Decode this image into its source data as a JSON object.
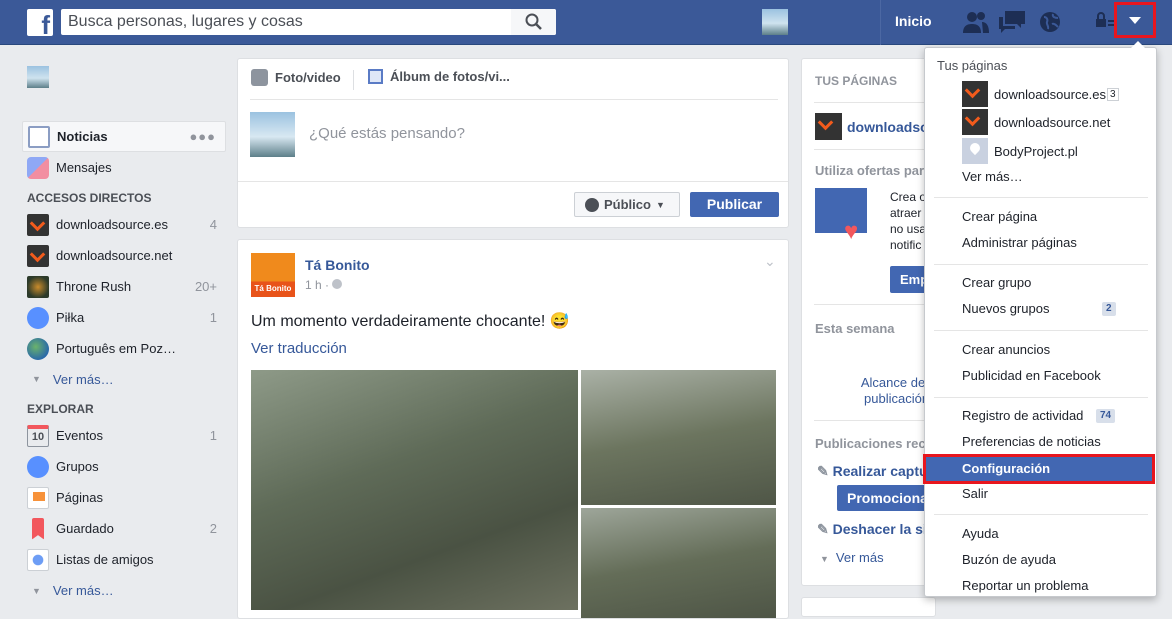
{
  "topbar": {
    "logo": "f",
    "search_placeholder": "Busca personas, lugares y cosas",
    "home": "Inicio",
    "icons": [
      "friend-requests-icon",
      "messages-icon",
      "notifications-globe-icon",
      "privacy-lock-icon",
      "account-menu-icon"
    ]
  },
  "sidebar": {
    "main": [
      {
        "label": "Noticias",
        "icon": "news-feed-icon"
      },
      {
        "label": "Mensajes",
        "icon": "messages-icon"
      }
    ],
    "shortcuts_title": "ACCESOS DIRECTOS",
    "shortcuts": [
      {
        "label": "downloadsource.es",
        "count": "4"
      },
      {
        "label": "downloadsource.net",
        "count": ""
      },
      {
        "label": "Throne Rush",
        "count": "20+"
      },
      {
        "label": "Piłka",
        "count": "1"
      },
      {
        "label": "Português em Poz…",
        "count": ""
      }
    ],
    "shortcuts_more": "Ver más…",
    "explore_title": "EXPLORAR",
    "explore": [
      {
        "label": "Eventos",
        "count": "1",
        "icon": "calendar-icon"
      },
      {
        "label": "Grupos",
        "count": "",
        "icon": "groups-icon"
      },
      {
        "label": "Páginas",
        "count": "",
        "icon": "flag-icon"
      },
      {
        "label": "Guardado",
        "count": "2",
        "icon": "bookmark-icon"
      },
      {
        "label": "Listas de amigos",
        "count": "",
        "icon": "friend-lists-icon"
      }
    ],
    "explore_more": "Ver más…",
    "calendar_day": "10"
  },
  "composer": {
    "photo_video": "Foto/video",
    "album": "Álbum de fotos/vi...",
    "placeholder": "¿Qué estás pensando?",
    "audience": "Público",
    "publish": "Publicar"
  },
  "post": {
    "author": "Tá Bonito",
    "avatar_text": "Tá Bonito",
    "time": "1 h",
    "text": "Um momento verdadeiramente chocante! 😅",
    "translate": "Ver traducción"
  },
  "right": {
    "title": "TUS PÁGINAS",
    "page": "downloadsource.es",
    "offers": "Utiliza ofertas para",
    "promo_lines": [
      "Crea o",
      "atraer",
      "no usa",
      "notific"
    ],
    "promo_btn": "Emp",
    "week": "Esta semana",
    "reach": [
      "Alcance de",
      "publicación"
    ],
    "recent": "Publicaciones rec",
    "actions": [
      {
        "label": "Realizar captu"
      },
      {
        "label": "Deshacer la si"
      }
    ],
    "promote": "Promocionar",
    "more": "Ver más"
  },
  "dropdown": {
    "pages_title": "Tus páginas",
    "pages": [
      {
        "label": "downloadsource.es",
        "badge": "3"
      },
      {
        "label": "downloadsource.net"
      },
      {
        "label": "BodyProject.pl"
      }
    ],
    "more": "Ver más…",
    "groups": [
      [
        {
          "label": "Crear página"
        },
        {
          "label": "Administrar páginas"
        }
      ],
      [
        {
          "label": "Crear grupo"
        },
        {
          "label": "Nuevos grupos",
          "badge": "2"
        }
      ],
      [
        {
          "label": "Crear anuncios"
        },
        {
          "label": "Publicidad en Facebook"
        }
      ],
      [
        {
          "label": "Registro de actividad",
          "badge": "74"
        },
        {
          "label": "Preferencias de noticias"
        },
        {
          "label": "Configuración",
          "highlighted": true
        },
        {
          "label": "Salir"
        }
      ],
      [
        {
          "label": "Ayuda"
        },
        {
          "label": "Buzón de ayuda"
        },
        {
          "label": "Reportar un problema"
        }
      ]
    ]
  },
  "colors": {
    "brand": "#3b5998",
    "button": "#4267b2",
    "highlight_border": "#e8161e",
    "link": "#365899"
  }
}
